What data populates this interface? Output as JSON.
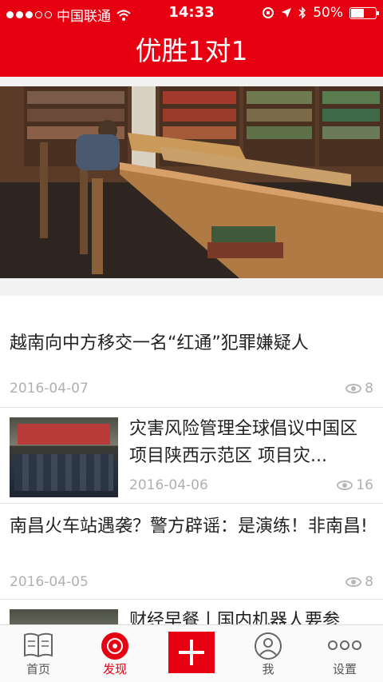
{
  "status_bar": {
    "carrier": "中国联通",
    "time": "14:33",
    "battery": "50%"
  },
  "header": {
    "title": "优胜1对1"
  },
  "articles": [
    {
      "title": "越南向中方移交一名“红通”犯罪嫌疑人",
      "date": "2016-04-07",
      "views": "8"
    },
    {
      "title": "灾害风险管理全球倡议中国区项目陕西示范区 项目灾...",
      "date": "2016-04-06",
      "views": "16"
    },
    {
      "title": "南昌火车站遇袭？警方辟谣：是演练！非南昌!",
      "date": "2016-04-05",
      "views": "8"
    },
    {
      "title": "财经早餐丨国内机器人要参"
    }
  ],
  "tabs": [
    {
      "label": "首页",
      "icon": "book-icon"
    },
    {
      "label": "发现",
      "icon": "disc-icon"
    },
    {
      "label": "",
      "icon": "plus-icon"
    },
    {
      "label": "我",
      "icon": "person-icon"
    },
    {
      "label": "设置",
      "icon": "more-icon"
    }
  ],
  "colors": {
    "brand": "#e60012"
  }
}
